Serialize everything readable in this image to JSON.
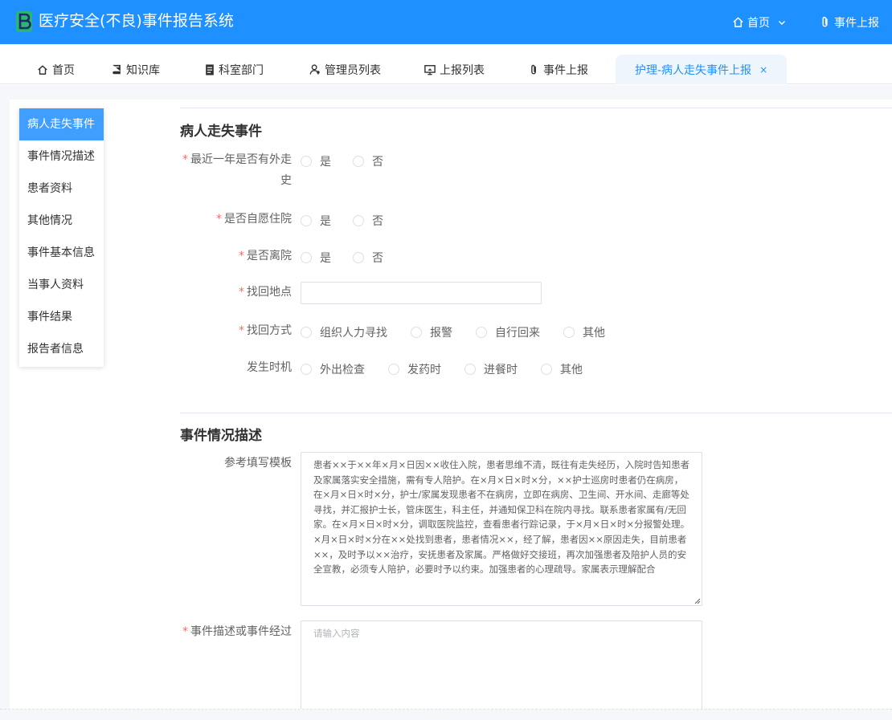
{
  "app": {
    "title": "医疗安全(不良)事件报告系统",
    "accent": "#1e90ff"
  },
  "top_nav": {
    "home": "首页",
    "report": "事件上报"
  },
  "tabs": [
    {
      "label": "首页",
      "icon": "home-icon"
    },
    {
      "label": "知识库",
      "icon": "book-icon"
    },
    {
      "label": "科室部门",
      "icon": "document-icon"
    },
    {
      "label": "管理员列表",
      "icon": "user-icon"
    },
    {
      "label": "上报列表",
      "icon": "monitor-icon"
    },
    {
      "label": "事件上报",
      "icon": "paperclip-icon"
    },
    {
      "label": "护理-病人走失事件上报",
      "active": true,
      "close": "×"
    }
  ],
  "anchors": [
    "病人走失事件",
    "事件情况描述",
    "患者资料",
    "其他情况",
    "事件基本信息",
    "当事人资料",
    "事件结果",
    "报告者信息"
  ],
  "section1": {
    "title": "病人走失事件",
    "q1": {
      "label": "最近一年是否有外走史",
      "options": [
        "是",
        "否"
      ]
    },
    "q2": {
      "label": "是否自愿住院",
      "options": [
        "是",
        "否"
      ]
    },
    "q3": {
      "label": "是否离院",
      "options": [
        "是",
        "否"
      ]
    },
    "q4": {
      "label": "找回地点",
      "value": ""
    },
    "q5": {
      "label": "找回方式",
      "options": [
        "组织人力寻找",
        "报警",
        "自行回来",
        "其他"
      ]
    },
    "q6": {
      "label": "发生时机",
      "options": [
        "外出检查",
        "发药时",
        "进餐时",
        "其他"
      ]
    }
  },
  "section2": {
    "title": "事件情况描述",
    "template_label": "参考填写模板",
    "template_text": "患者××于××年×月×日因××收住入院，患者思维不清，既往有走失经历，入院时告知患者及家属落实安全措施，需有专人陪护。在×月×日×时×分，××护士巡房时患者仍在病房，在×月×日×时×分，护士/家属发现患者不在病房，立即在病房、卫生间、开水间、走廊等处寻找，并汇报护士长，管床医生，科主任，并通知保卫科在院内寻找。联系患者家属有/无回家。在×月×日×时×分，调取医院监控，查看患者行踪记录，于×月×日×时×分报警处理。×月×日×时×分在××处找到患者，患者情况××，经了解，患者因××原因走失，目前患者××，及时予以××治疗，安抚患者及家属。严格做好交接班，再次加强患者及陪护人员的安全宣教，必须专人陪护，必要时予以约束。加强患者的心理疏导。家属表示理解配合",
    "desc_label": "事件描述或事件经过",
    "desc_placeholder": "请输入内容",
    "required_mark": "*"
  }
}
